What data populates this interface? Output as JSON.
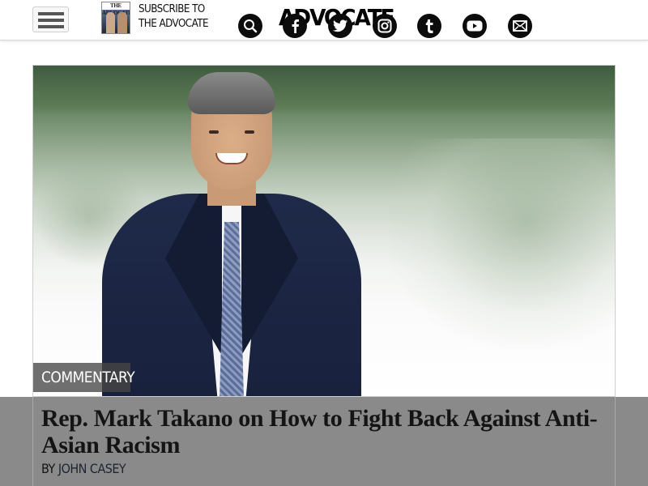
{
  "header": {
    "menu_icon": "hamburger-menu-icon",
    "magazine_cover": {
      "masthead": "THE ADVOCATE",
      "icon": "magazine-cover-image"
    },
    "subscribe": {
      "line1": "SUBSCRIBE TO",
      "line2": "THE ADVOCATE"
    },
    "logo": "ADVOCATE",
    "icons": [
      "search-icon",
      "facebook-icon",
      "twitter-icon",
      "instagram-icon",
      "tumblr-icon",
      "youtube-icon",
      "email-icon"
    ]
  },
  "article": {
    "category": "COMMENTARY",
    "headline": "Rep. Mark Takano on How to Fight Back Against Anti-Asian Racism",
    "byline_prefix": "BY",
    "author": "JOHN CASEY",
    "hero_image": "photo-man-in-suit-by-lake"
  },
  "colors": {
    "header_bg": "#ffffff",
    "icon_circle": "#0c0c0c",
    "title_overlay": "#8a8a8a",
    "category_bg": "#464646"
  }
}
